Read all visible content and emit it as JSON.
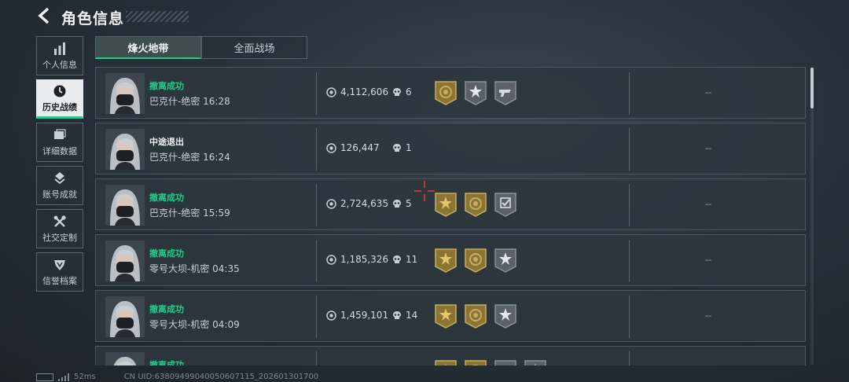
{
  "header": {
    "title": "角色信息"
  },
  "sidebar": {
    "items": [
      {
        "label": "个人信息",
        "icon": "bar-chart-icon"
      },
      {
        "label": "历史战绩",
        "icon": "clock-icon"
      },
      {
        "label": "详细数据",
        "icon": "folder-icon"
      },
      {
        "label": "账号成就",
        "icon": "achievement-icon"
      },
      {
        "label": "社交定制",
        "icon": "tools-icon"
      },
      {
        "label": "信誉档案",
        "icon": "shield-icon"
      }
    ]
  },
  "tabs": [
    {
      "label": "烽火地带"
    },
    {
      "label": "全面战场"
    }
  ],
  "rows": [
    {
      "status": "撤离成功",
      "status_color": "#1fce8a",
      "map": "巴克什-绝密 16:28",
      "money": "4,112,606",
      "kills": "6",
      "badges": [
        "gold-target",
        "gray-star",
        "gray-gun"
      ],
      "result": "--"
    },
    {
      "status": "中途退出",
      "status_color": "#f0f2f4",
      "map": "巴克什-绝密 16:24",
      "money": "126,447",
      "kills": "1",
      "badges": [],
      "result": "--"
    },
    {
      "status": "撤离成功",
      "status_color": "#1fce8a",
      "map": "巴克什-绝密 15:59",
      "money": "2,724,635",
      "kills": "5",
      "badges": [
        "gold-star",
        "gold-target",
        "gray-check"
      ],
      "result": "--"
    },
    {
      "status": "撤离成功",
      "status_color": "#1fce8a",
      "map": "零号大坝-机密 04:35",
      "money": "1,185,326",
      "kills": "11",
      "badges": [
        "gold-star",
        "gold-target",
        "gray-star"
      ],
      "result": "--"
    },
    {
      "status": "撤离成功",
      "status_color": "#1fce8a",
      "map": "零号大坝-机密 04:09",
      "money": "1,459,101",
      "kills": "14",
      "badges": [
        "gold-star",
        "gold-target",
        "gray-star"
      ],
      "result": "--"
    },
    {
      "status": "撤离成功",
      "status_color": "#1fce8a",
      "map": "",
      "money": "",
      "kills": "",
      "badges": [
        "gold-star",
        "gold-target",
        "gray-gun",
        "gray-star"
      ],
      "result": ""
    }
  ],
  "footer": {
    "ping": "52ms",
    "uid": "CN UID:638094990400506071​15_202601301700"
  }
}
